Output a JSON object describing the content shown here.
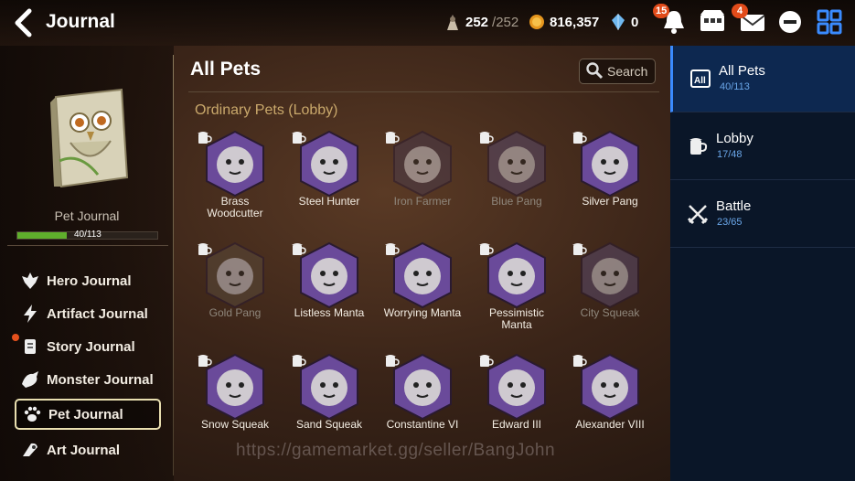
{
  "header": {
    "title": "Journal",
    "stamina": "252",
    "stamina_max": "/252",
    "gold": "816,357",
    "gems": "0",
    "notification_badge": "15",
    "mail_badge": "4"
  },
  "sidebar": {
    "pet_journal_label": "Pet Journal",
    "pet_journal_progress": "40/113",
    "pet_journal_fraction": 0.354,
    "items": [
      {
        "label": "Hero Journal",
        "icon": "hero-icon"
      },
      {
        "label": "Artifact Journal",
        "icon": "lightning-icon"
      },
      {
        "label": "Story Journal",
        "icon": "scroll-icon"
      },
      {
        "label": "Monster Journal",
        "icon": "dragon-icon"
      },
      {
        "label": "Pet Journal",
        "icon": "paw-icon"
      },
      {
        "label": "Art Journal",
        "icon": "art-icon"
      }
    ]
  },
  "main": {
    "title": "All Pets",
    "search_label": "Search",
    "section_title": "Ordinary Pets (Lobby)",
    "watermark": "https://gamemarket.gg/seller/BangJohn",
    "pets": [
      {
        "name": "Brass\nWoodcutter",
        "color": "#6a4a9a",
        "owned": true
      },
      {
        "name": "Steel Hunter",
        "color": "#6a4a9a",
        "owned": true
      },
      {
        "name": "Iron Farmer",
        "color": "#4a3a4a",
        "owned": false
      },
      {
        "name": "Blue Pang",
        "color": "#5a4a6a",
        "owned": false
      },
      {
        "name": "Silver Pang",
        "color": "#6a4a9a",
        "owned": true
      },
      {
        "name": "Gold Pang",
        "color": "#5a4a3a",
        "owned": false
      },
      {
        "name": "Listless Manta",
        "color": "#6a4a9a",
        "owned": true
      },
      {
        "name": "Worrying Manta",
        "color": "#6a4a9a",
        "owned": true
      },
      {
        "name": "Pessimistic\nManta",
        "color": "#6a4a9a",
        "owned": true
      },
      {
        "name": "City Squeak",
        "color": "#5a4a6a",
        "owned": false
      },
      {
        "name": "Snow Squeak",
        "color": "#6a4a9a",
        "owned": true
      },
      {
        "name": "Sand Squeak",
        "color": "#6a4a9a",
        "owned": true
      },
      {
        "name": "Constantine VI",
        "color": "#6a4a9a",
        "owned": true
      },
      {
        "name": "Edward III",
        "color": "#6a4a9a",
        "owned": true
      },
      {
        "name": "Alexander VIII",
        "color": "#6a4a9a",
        "owned": true
      }
    ]
  },
  "categories": [
    {
      "name": "All Pets",
      "count": "40/113",
      "icon": "all-icon",
      "active": true
    },
    {
      "name": "Lobby",
      "count": "17/48",
      "icon": "mug-icon",
      "active": false
    },
    {
      "name": "Battle",
      "count": "23/65",
      "icon": "swords-icon",
      "active": false
    }
  ],
  "colors": {
    "accent_blue": "#3a8bff",
    "progress_green": "#5fae2c",
    "section_gold": "#c9a86b",
    "badge_red": "#e14b1a"
  }
}
